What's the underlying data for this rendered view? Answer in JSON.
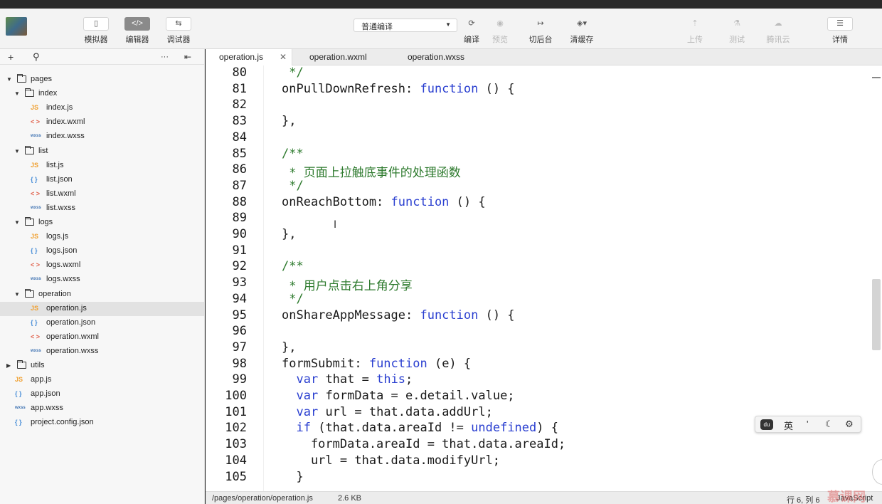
{
  "toolbar": {
    "simulator": "模拟器",
    "editor": "编辑器",
    "debugger": "调试器",
    "compile_mode": "普通编译",
    "compile": "编译",
    "preview": "预览",
    "switch_backend": "切后台",
    "clear_cache": "清缓存",
    "upload": "上传",
    "test": "测试",
    "tencent_cloud": "腾讯云",
    "details": "详情"
  },
  "sidebar": {
    "tree": [
      {
        "label": "pages",
        "type": "folder",
        "level": 0,
        "expanded": true
      },
      {
        "label": "index",
        "type": "folder",
        "level": 1,
        "expanded": true
      },
      {
        "label": "index.js",
        "type": "js",
        "level": 2
      },
      {
        "label": "index.wxml",
        "type": "wxml",
        "level": 2
      },
      {
        "label": "index.wxss",
        "type": "wxss",
        "level": 2
      },
      {
        "label": "list",
        "type": "folder",
        "level": 1,
        "expanded": true
      },
      {
        "label": "list.js",
        "type": "js",
        "level": 2
      },
      {
        "label": "list.json",
        "type": "json",
        "level": 2
      },
      {
        "label": "list.wxml",
        "type": "wxml",
        "level": 2
      },
      {
        "label": "list.wxss",
        "type": "wxss",
        "level": 2
      },
      {
        "label": "logs",
        "type": "folder",
        "level": 1,
        "expanded": true
      },
      {
        "label": "logs.js",
        "type": "js",
        "level": 2
      },
      {
        "label": "logs.json",
        "type": "json",
        "level": 2
      },
      {
        "label": "logs.wxml",
        "type": "wxml",
        "level": 2
      },
      {
        "label": "logs.wxss",
        "type": "wxss",
        "level": 2
      },
      {
        "label": "operation",
        "type": "folder",
        "level": 1,
        "expanded": true
      },
      {
        "label": "operation.js",
        "type": "js",
        "level": 2,
        "selected": true
      },
      {
        "label": "operation.json",
        "type": "json",
        "level": 2
      },
      {
        "label": "operation.wxml",
        "type": "wxml",
        "level": 2
      },
      {
        "label": "operation.wxss",
        "type": "wxss",
        "level": 2
      },
      {
        "label": "utils",
        "type": "folder",
        "level": 0,
        "expanded": false
      },
      {
        "label": "app.js",
        "type": "js",
        "level": 0
      },
      {
        "label": "app.json",
        "type": "json",
        "level": 0
      },
      {
        "label": "app.wxss",
        "type": "wxss",
        "level": 0
      },
      {
        "label": "project.config.json",
        "type": "json",
        "level": 0
      }
    ]
  },
  "tabs": [
    {
      "label": "operation.js",
      "active": true
    },
    {
      "label": "operation.wxml",
      "active": false
    },
    {
      "label": "operation.wxss",
      "active": false
    }
  ],
  "code": [
    {
      "n": "80",
      "segs": [
        [
          " */",
          "cm"
        ]
      ]
    },
    {
      "n": "81",
      "segs": [
        [
          "onPullDownRefresh: ",
          ""
        ],
        [
          "function",
          "kw"
        ],
        [
          " () {",
          ""
        ]
      ]
    },
    {
      "n": "82",
      "segs": []
    },
    {
      "n": "83",
      "segs": [
        [
          "},",
          ""
        ]
      ]
    },
    {
      "n": "84",
      "segs": []
    },
    {
      "n": "85",
      "segs": [
        [
          "/**",
          "cm"
        ]
      ]
    },
    {
      "n": "86",
      "segs": [
        [
          " * 页面上拉触底事件的处理函数",
          "cm"
        ]
      ]
    },
    {
      "n": "87",
      "segs": [
        [
          " */",
          "cm"
        ]
      ]
    },
    {
      "n": "88",
      "segs": [
        [
          "onReachBottom: ",
          ""
        ],
        [
          "function",
          "kw"
        ],
        [
          " () {",
          ""
        ]
      ]
    },
    {
      "n": "89",
      "segs": []
    },
    {
      "n": "90",
      "segs": [
        [
          "},",
          ""
        ]
      ]
    },
    {
      "n": "91",
      "segs": []
    },
    {
      "n": "92",
      "segs": [
        [
          "/**",
          "cm"
        ]
      ]
    },
    {
      "n": "93",
      "segs": [
        [
          " * 用户点击右上角分享",
          "cm"
        ]
      ]
    },
    {
      "n": "94",
      "segs": [
        [
          " */",
          "cm"
        ]
      ]
    },
    {
      "n": "95",
      "segs": [
        [
          "onShareAppMessage: ",
          ""
        ],
        [
          "function",
          "kw"
        ],
        [
          " () {",
          ""
        ]
      ]
    },
    {
      "n": "96",
      "segs": []
    },
    {
      "n": "97",
      "segs": [
        [
          "},",
          ""
        ]
      ]
    },
    {
      "n": "98",
      "segs": [
        [
          "formSubmit: ",
          ""
        ],
        [
          "function",
          "kw"
        ],
        [
          " (e) {",
          ""
        ]
      ]
    },
    {
      "n": "99",
      "segs": [
        [
          "  ",
          ""
        ],
        [
          "var",
          "kw"
        ],
        [
          " that = ",
          ""
        ],
        [
          "this",
          "kw"
        ],
        [
          ";",
          ""
        ]
      ]
    },
    {
      "n": "100",
      "segs": [
        [
          "  ",
          ""
        ],
        [
          "var",
          "kw"
        ],
        [
          " formData = e.detail.value;",
          ""
        ]
      ]
    },
    {
      "n": "101",
      "segs": [
        [
          "  ",
          ""
        ],
        [
          "var",
          "kw"
        ],
        [
          " url = that.data.addUrl;",
          ""
        ]
      ]
    },
    {
      "n": "102",
      "segs": [
        [
          "  ",
          ""
        ],
        [
          "if",
          "kw"
        ],
        [
          " (that.data.areaId != ",
          ""
        ],
        [
          "undefined",
          "kw"
        ],
        [
          ") {",
          ""
        ]
      ]
    },
    {
      "n": "103",
      "segs": [
        [
          "    formData.areaId = that.data.areaId;",
          ""
        ]
      ]
    },
    {
      "n": "104",
      "segs": [
        [
          "    url = that.data.modifyUrl;",
          ""
        ]
      ]
    },
    {
      "n": "105",
      "segs": [
        [
          "  }",
          ""
        ]
      ]
    }
  ],
  "ime": {
    "lang": "英",
    "punct": "'",
    "moon": "☾",
    "gear": "⚙"
  },
  "status": {
    "path": "/pages/operation/operation.js",
    "size": "2.6 KB",
    "position": "行 6, 列 6",
    "language": "JavaScript"
  },
  "colors": {
    "keyword": "#2a3fd0",
    "comment": "#2d7a2d"
  }
}
